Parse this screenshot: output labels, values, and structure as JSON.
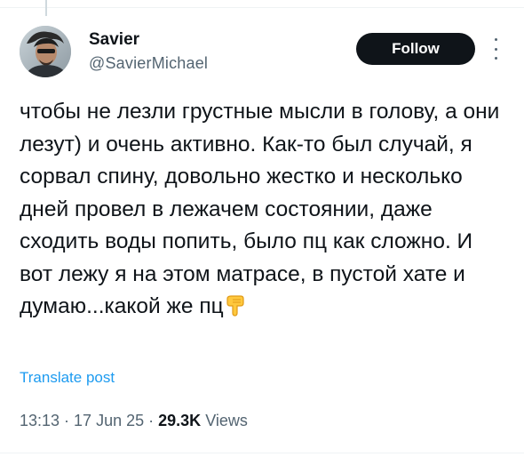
{
  "tweet": {
    "author": {
      "display_name": "Savier",
      "handle": "@SavierMichael",
      "avatar_icon": "profile-photo"
    },
    "follow_label": "Follow",
    "text": "чтобы не лезли грустные мысли в голову, а они лезут) и очень активно. Как-то был случай, я сорвал спину, довольно жестко и несколько дней провел в лежачем состоянии, даже сходить воды попить, было пц как сложно. И вот лежу я на этом матрасе, в пустой хате и думаю...какой же пц",
    "text_emoji": "backhand-index-pointing-down",
    "translate_label": "Translate post",
    "time": "13:13",
    "date": "17 Jun 25",
    "separator": "·",
    "views_count": "29.3K",
    "views_label": "Views"
  },
  "colors": {
    "text_primary": "#0f1419",
    "text_secondary": "#536471",
    "link_blue": "#1d9bf0",
    "follow_bg": "#0f1419"
  }
}
